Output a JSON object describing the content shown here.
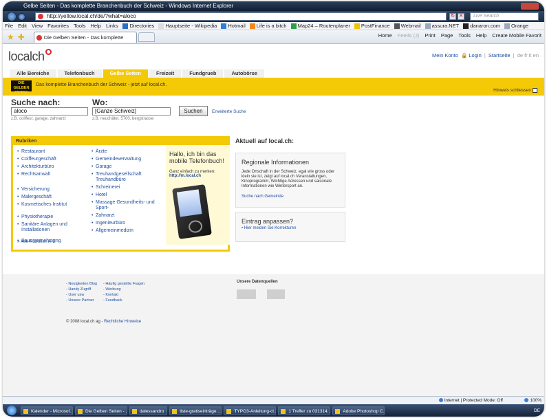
{
  "window": {
    "title": "Gelbe Seiten - Das komplette Branchenbuch der Schweiz - Windows Internet Explorer",
    "url": "http://yellow.local.ch/de/?what=aloco",
    "live_search": "Live Search"
  },
  "menu": [
    "File",
    "Edit",
    "View",
    "Favorites",
    "Tools",
    "Help"
  ],
  "links_label": "Links",
  "links": [
    "Directories",
    "Hauptseite - Wikipedia",
    "Hotmail",
    "Life is a bitch",
    "Map24 – Routenplaner",
    "PostFinance",
    "Webmail",
    "assura.NET",
    "danaron.com",
    "Orange"
  ],
  "tab": {
    "label": "Die Gelben Seiten - Das komplette Branchenbuch..."
  },
  "commands": [
    "Home",
    "Feeds (J)",
    "Print",
    "Page",
    "Tools",
    "Help",
    "Create Mobile Favorit"
  ],
  "site": {
    "logo": "localch",
    "top_links": {
      "account": "Mein Konto",
      "login": "Login",
      "start": "Startseite",
      "langs": "de fr it en"
    },
    "nav": [
      "Alle Bereiche",
      "Telefonbuch",
      "Gelbe Seiten",
      "Freizeit",
      "Fundgrueb",
      "Autobörse"
    ],
    "badge": "DIE GELBEN SEITEN",
    "claim": "Das komplette Branchenbuch der Schweiz - jetzt auf local.ch.",
    "hide_hint": "Hinweis schliessen"
  },
  "search": {
    "what_label": "Suche nach:",
    "what_value": "aloco",
    "what_hint": "z.B. coiffeur, garage, zahnarzt",
    "where_label": "Wo:",
    "where_value": "[Ganze Schweiz]",
    "where_hint": "z.B. neuchâtel, 5700, bergstrasse",
    "button": "Suchen",
    "advanced": "Erweiterte Suche"
  },
  "rubriken": {
    "title": "Rubriken",
    "col1": [
      "Restaurant",
      "Coiffeurgeschäft",
      "Architekturbüro",
      "Rechtsanwalt",
      "Versicherung",
      "Malergeschäft",
      "Kosmetisches Institut",
      "Physiotherapie",
      "Sanitäre Anlagen und Installationen",
      "Bauunternehmung"
    ],
    "col2": [
      "Ärzte",
      "Gemeindeverwaltung",
      "Garage",
      "Treuhandgesellschaft Treuhandbüro",
      "Schreinerei",
      "Hotel",
      "Massage Gesundheits- und Sport-",
      "Zahnarzt",
      "Ingenieurbüro",
      "Allgemeinmedizin"
    ],
    "all": "Alle Rubriken A-Z"
  },
  "promo": {
    "title": "Hallo, ich bin das mobile Telefonbuch!",
    "sub": "Ganz einfach zu merken:",
    "link": "http://m.local.ch"
  },
  "aktuell": {
    "heading": "Aktuell auf local.ch:",
    "box1": {
      "title": "Regionale Informationen",
      "text": "Jede Ortschaft in der Schweiz, egal wie gross oder klein sie ist, zeigt auf local.ch Veranstaltungen, Kinoprogramm, Wichtige Adressen und saisonale Informationen wie Wintersport an.",
      "link": "Suche nach Gemeinde"
    },
    "box2": {
      "title": "Eintrag anpassen?",
      "link": "Hier melden Sie Korrekturen"
    }
  },
  "footer": {
    "col1": [
      "Neuigkeiten Blog",
      "Handy Zugriff",
      "User usw",
      "Unsere Partner"
    ],
    "col2": [
      "Häufig gestellte Fragen",
      "Werbung",
      "Kontakt",
      "Feedback"
    ],
    "sources": "Unsere Datenquellen",
    "copyright": "© 2008 local.ch ag -",
    "legal": "Rechtliche Hinweise"
  },
  "status": {
    "zone": "Internet | Protected Mode: Off",
    "zoom": "100%"
  },
  "taskbar": [
    "Kalender - Microsof...",
    "Die Gelben Seiten - ...",
    "dalessandro",
    "liste-gratiseinträge....",
    "TYPO3-Anleitung-cl...",
    "1 Treffer zu 031314...",
    "Adobe Photoshop C..."
  ],
  "tray": "DE"
}
